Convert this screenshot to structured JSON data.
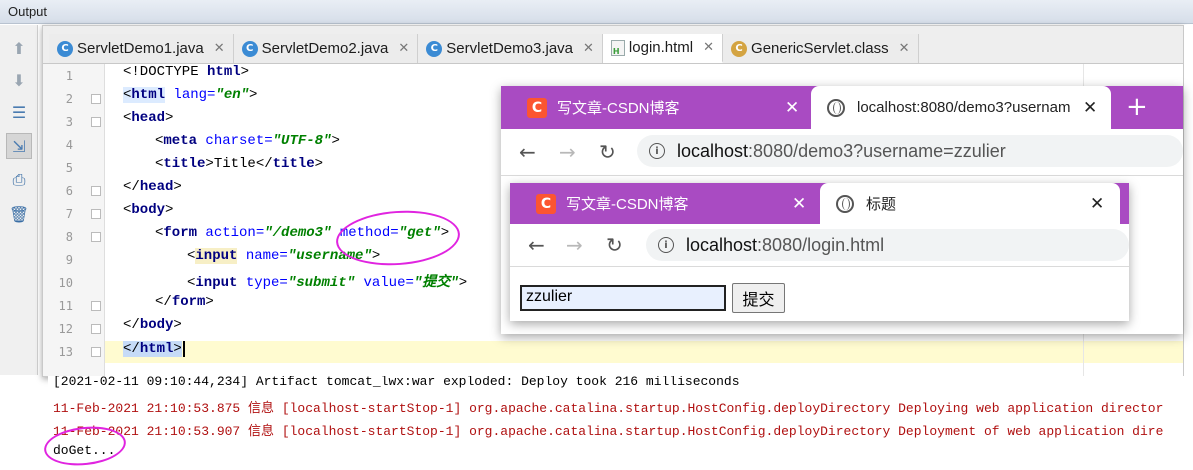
{
  "panel": {
    "title": "Output"
  },
  "toolbar_icons": [
    "arrow-up-icon",
    "arrow-down-icon",
    "soft-wrap-icon",
    "scroll-to-end-icon",
    "print-icon",
    "trash-icon"
  ],
  "editor": {
    "tabs": [
      {
        "label": "ServletDemo1.java",
        "icon": "java-class-icon"
      },
      {
        "label": "ServletDemo2.java",
        "icon": "java-class-icon"
      },
      {
        "label": "ServletDemo3.java",
        "icon": "java-class-icon"
      },
      {
        "label": "login.html",
        "icon": "html-file-icon",
        "active": true
      },
      {
        "label": "GenericServlet.class",
        "icon": "class-file-icon"
      }
    ],
    "line_numbers": [
      "1",
      "2",
      "3",
      "4",
      "5",
      "6",
      "7",
      "8",
      "9",
      "10",
      "11",
      "12",
      "13"
    ],
    "code": {
      "l1_text": "<!DOCTYPE ",
      "l1_tag": "html",
      "l1_end": ">",
      "l2_open": "<",
      "l2_tag": "html",
      "l2_attr": " lang=",
      "l2_val": "\"en\"",
      "l2_end": ">",
      "l3_open": "<",
      "l3_tag": "head",
      "l3_end": ">",
      "l4_open": "<",
      "l4_tag": "meta",
      "l4_attr": " charset=",
      "l4_val": "\"UTF-8\"",
      "l4_end": ">",
      "l5_open": "<",
      "l5_tag": "title",
      "l5_mid": ">Title</",
      "l5_tag2": "title",
      "l5_end": ">",
      "l6_open": "</",
      "l6_tag": "head",
      "l6_end": ">",
      "l7_open": "<",
      "l7_tag": "body",
      "l7_end": ">",
      "l8_open": "<",
      "l8_tag": "form",
      "l8_attr1": " action=",
      "l8_val1": "\"/demo3\"",
      "l8_attr2": " method=",
      "l8_val2": "\"get\"",
      "l8_end": ">",
      "l9_open": "<",
      "l9_tag": "input",
      "l9_attr": " name=",
      "l9_val": "\"username\"",
      "l9_end": ">",
      "l10_open": "<",
      "l10_tag": "input",
      "l10_attr1": " type=",
      "l10_val1": "\"submit\"",
      "l10_attr2": " value=",
      "l10_val2": "\"提交\"",
      "l10_end": ">",
      "l11_open": "</",
      "l11_tag": "form",
      "l11_end": ">",
      "l12_open": "</",
      "l12_tag": "body",
      "l12_end": ">",
      "l13_open": "</",
      "l13_tag": "html",
      "l13_end": ">"
    }
  },
  "browser_back": {
    "tab1": {
      "label": "写文章-CSDN博客",
      "close": "✕"
    },
    "tab2": {
      "label": "localhost:8080/demo3?usernam",
      "close": "✕"
    },
    "new_tab": "+",
    "address": {
      "host": "localhost",
      "path": ":8080/demo3?username=zzulier"
    }
  },
  "browser_front": {
    "tab1": {
      "label": "写文章-CSDN博客",
      "close": "✕"
    },
    "tab2": {
      "label": "标题",
      "close": "✕"
    },
    "address": {
      "host": "localhost",
      "path": ":8080/login.html"
    },
    "form": {
      "username_value": "zzulier",
      "submit_label": "提交"
    }
  },
  "console": {
    "lines": [
      "[2021-02-11 09:10:44,234] Artifact tomcat_lwx:war exploded: Deploy took 216 milliseconds",
      "11-Feb-2021 21:10:53.875 信息 [localhost-startStop-1] org.apache.catalina.startup.HostConfig.deployDirectory Deploying web application director",
      "11-Feb-2021 21:10:53.907 信息 [localhost-startStop-1] org.apache.catalina.startup.HostConfig.deployDirectory Deployment of web application dire",
      "doGet..."
    ]
  },
  "colors": {
    "annotation": "#e024e0",
    "browser_tab_bar": "#a94bc2",
    "csdn": "#fc5531"
  }
}
